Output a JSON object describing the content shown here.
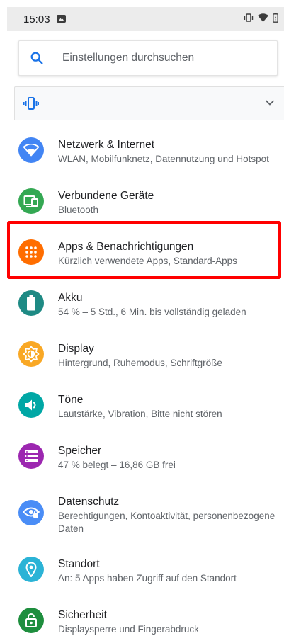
{
  "status_bar": {
    "time": "15:03"
  },
  "search": {
    "placeholder": "Einstellungen durchsuchen"
  },
  "colors": {
    "network": "#4285f4",
    "devices": "#34a853",
    "apps": "#ff6d00",
    "battery": "#1e8a84",
    "display": "#f9a825",
    "sound": "#00a7a5",
    "storage": "#9c27b0",
    "privacy": "#4a8df6",
    "location": "#2bb3d6",
    "security": "#1e8e3e",
    "highlight": "#ff0000"
  },
  "settings": [
    {
      "title": "Netzwerk & Internet",
      "summary": "WLAN, Mobilfunknetz, Datennutzung und Hotspot",
      "icon": "wifi-icon"
    },
    {
      "title": "Verbundene Geräte",
      "summary": "Bluetooth",
      "icon": "devices-icon"
    },
    {
      "title": "Apps & Benachrichtigungen",
      "summary": "Kürzlich verwendete Apps, Standard-Apps",
      "icon": "apps-grid-icon"
    },
    {
      "title": "Akku",
      "summary": "54 % – 5 Std., 6 Min. bis vollständig geladen",
      "icon": "battery-icon"
    },
    {
      "title": "Display",
      "summary": "Hintergrund, Ruhemodus, Schriftgröße",
      "icon": "brightness-icon"
    },
    {
      "title": "Töne",
      "summary": "Lautstärke, Vibration, Bitte nicht stören",
      "icon": "volume-icon"
    },
    {
      "title": "Speicher",
      "summary": "47 % belegt – 16,86 GB frei",
      "icon": "storage-icon"
    },
    {
      "title": "Datenschutz",
      "summary": "Berechtigungen, Kontoaktivität, personenbezogene Daten",
      "icon": "privacy-eye-icon"
    },
    {
      "title": "Standort",
      "summary": "An: 5 Apps haben Zugriff auf den Standort",
      "icon": "location-pin-icon"
    },
    {
      "title": "Sicherheit",
      "summary": "Displaysperre und Fingerabdruck",
      "icon": "lock-icon"
    }
  ]
}
